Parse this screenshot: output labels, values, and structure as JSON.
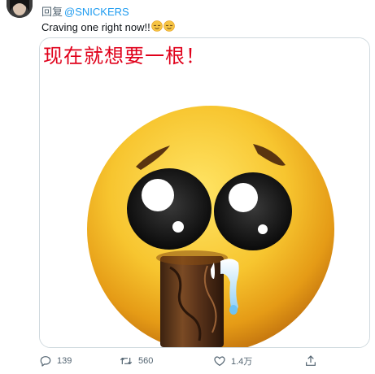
{
  "reply_header": {
    "prefix": "回复",
    "mention": "@SNICKERS"
  },
  "tweet": {
    "text": "Craving one right now!!",
    "emojis": [
      "relieved-face",
      "relieved-face"
    ]
  },
  "media": {
    "caption": "现在就想要一根！",
    "caption_color": "#e0001a",
    "alt": "pleading face emoji holding a chocolate bar"
  },
  "actions": {
    "reply_count": "139",
    "retweet_count": "560",
    "like_count": "1.4万"
  },
  "colors": {
    "accent": "#1d9bf0",
    "muted": "#536471",
    "text": "#0f1419"
  }
}
